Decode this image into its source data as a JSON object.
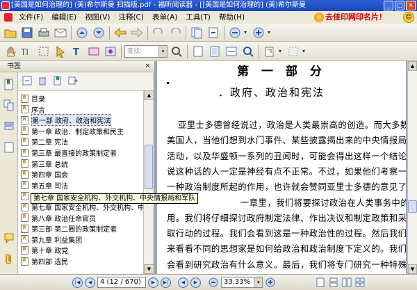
{
  "window": {
    "title": "[美国是如何治理的] (美)希尔斯曼 扫描版.pdf - 福昕阅读器 - [[美国是如何治理的] (美)希尔斯曼"
  },
  "menu": {
    "items": [
      "文件(F)",
      "编辑(E)",
      "视图(V)",
      "注释(C)",
      "表单(A)",
      "工具(T)",
      "帮助(H)"
    ],
    "ad_text": "去佳印网印名片！"
  },
  "toolbar": {
    "zoom_placeholder": "查找:"
  },
  "bookmarks": {
    "header": "书签",
    "items": [
      {
        "label": "目录"
      },
      {
        "label": "序言"
      },
      {
        "label": "第一部 政府、政治和宪法",
        "selected": true
      },
      {
        "label": "第一章 政治、制定政策和民主"
      },
      {
        "label": "第二章 宪法"
      },
      {
        "label": "第三章 最直接的政策制定者"
      },
      {
        "label": "第三章 总统"
      },
      {
        "label": "第四章 国会"
      },
      {
        "label": "第五章 司法"
      },
      {
        "label": "第六章 官僚"
      },
      {
        "label": "第七章 国家安全机构、外交机构、中央情报局和军队"
      },
      {
        "label": "第八章 政治任命官员"
      },
      {
        "label": "第三部 第二圈的政策制定者"
      },
      {
        "label": "第九章 利益集团"
      },
      {
        "label": "第十章 政党"
      },
      {
        "label": "第四部 选民"
      }
    ],
    "tooltip": "第七章 国家安全机构、外交机构、中央情报局和军队"
  },
  "document": {
    "heading": "第 一 部 分",
    "subheading": "．政府、政治和宪法",
    "lines": [
      "亚里士多德曾经说过，政治是人类最崇高的创造。而大多数",
      "美国人，当他们想到水门事件、某些披露揭出来的中央情报局的",
      "活动，以及华盛顿一系列的丑闻时，可能会得出这样一个结论：",
      "说这种话的人一定是神经有点不正常。不过，如果他们考察一下",
      "一种政治制度所起的作用，也许就会赞同亚里士多德的意见了。",
      "一章里，我们将要探讨政治在人类事务中的作",
      "用。我们将仔细探讨政府制定法律、作出决议和制定政策和采",
      "取行动的过程。我们会看到这是一种政治性的过程。然后我们再",
      "来看看不同的思想家是如何给政治和政治制度下定义的。我们还",
      "会看到研究政治有什么意义。最后，我们将专门研究一种特殊的"
    ]
  },
  "status": {
    "page_indicator": "4 (12 / 670)",
    "zoom": "33.33%"
  }
}
